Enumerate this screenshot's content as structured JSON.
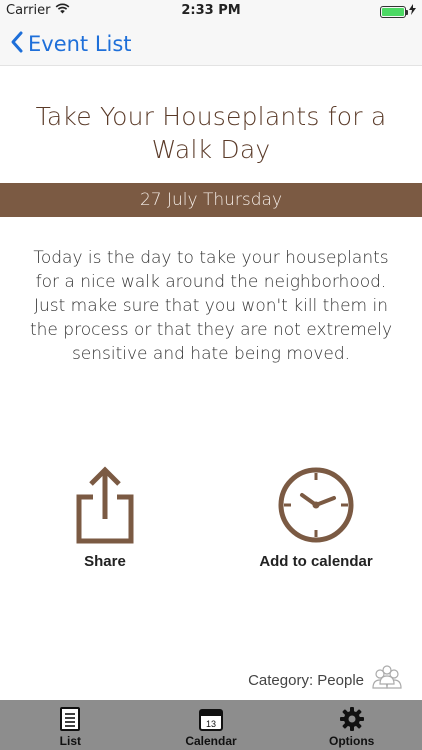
{
  "status_bar": {
    "carrier": "Carrier",
    "time": "2:33 PM"
  },
  "nav": {
    "back_label": "Event List"
  },
  "event": {
    "title": "Take Your Houseplants for a Walk Day",
    "date": "27 July Thursday",
    "description": "Today is the day to take your houseplants for a nice walk around the neighborhood. Just make sure that you won't kill them in the process or that they are not extremely sensitive and hate being moved."
  },
  "actions": {
    "share_label": "Share",
    "calendar_label": "Add to calendar"
  },
  "category": {
    "text": "Category: People"
  },
  "tabs": {
    "list": "List",
    "calendar": "Calendar",
    "calendar_day": "13",
    "options": "Options"
  },
  "colors": {
    "brown": "#7b5a43",
    "back_blue": "#1e6fd9",
    "tab_bg": "#8d8d8d",
    "battery_green": "#4cd964"
  }
}
